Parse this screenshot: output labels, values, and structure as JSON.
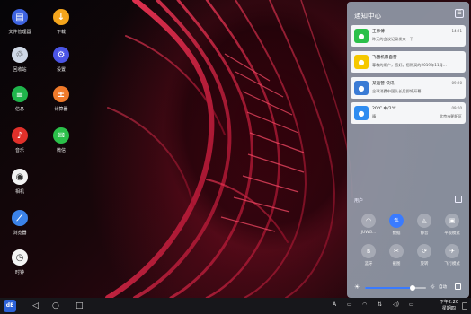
{
  "desktop": {
    "icons": [
      {
        "label": "文件管理器",
        "icon": "folder-icon",
        "color": "#3d63e0",
        "glyph": "▤"
      },
      {
        "label": "下载",
        "icon": "download-icon",
        "color": "#f5a51c",
        "glyph": "↓"
      },
      {
        "label": "回收站",
        "icon": "trash-icon",
        "color": "#cfd8e6",
        "glyph": "♲"
      },
      {
        "label": "设置",
        "icon": "settings-icon",
        "color": "#4b55e6",
        "glyph": "⚙"
      },
      {
        "label": "信息",
        "icon": "message-icon",
        "color": "#1fb44b",
        "glyph": "≡"
      },
      {
        "label": "计算器",
        "icon": "calculator-icon",
        "color": "#f07a2a",
        "glyph": "±"
      },
      {
        "label": "音乐",
        "icon": "music-icon",
        "color": "#e0302a",
        "glyph": "♪"
      },
      {
        "label": "微信",
        "icon": "wechat-icon",
        "color": "#2bc04a",
        "glyph": "✉"
      },
      {
        "label": "相机",
        "icon": "camera-icon",
        "color": "#f2f2f2",
        "glyph": "◉"
      },
      {
        "label": "浏览器",
        "icon": "browser-icon",
        "color": "#3b82e8",
        "glyph": "⟋"
      },
      {
        "label": "时钟",
        "icon": "clock-icon",
        "color": "#f4f4f4",
        "glyph": "◷"
      }
    ]
  },
  "notification_center": {
    "title": "通知中心",
    "clear_icon": "clear-icon",
    "notifications": [
      {
        "app": "王师傅",
        "body": "昨天的会议记录发来一下",
        "time": "14:21",
        "right": "",
        "icon": "wechat-icon",
        "icon_color": "#2bc04a"
      },
      {
        "app": "飞猪机票自营",
        "body": "尊敬的用户，您好。您购买的2019年11月...",
        "time": "",
        "right": "",
        "icon": "flight-icon",
        "icon_color": "#f5c800"
      },
      {
        "app": "某运营·快讯",
        "body": "全球消费中国队长后即将开幕",
        "time": "09:20",
        "right": "",
        "icon": "news-icon",
        "icon_color": "#3a7bd5"
      },
      {
        "app": "20℃ 中/2℃",
        "body": "晴",
        "time": "09:00",
        "right": "北京市朝阳区",
        "icon": "weather-icon",
        "icon_color": "#2f8cf0"
      }
    ],
    "user_label": "用户",
    "edit_icon": "edit-icon",
    "quick_settings": [
      {
        "label": "JUWG...",
        "icon": "wifi-icon",
        "on": false,
        "glyph": "◠"
      },
      {
        "label": "数据",
        "icon": "data-icon",
        "on": true,
        "glyph": "⇅"
      },
      {
        "label": "静音",
        "icon": "bell-icon",
        "on": false,
        "glyph": "◬"
      },
      {
        "label": "平板模式",
        "icon": "tablet-icon",
        "on": false,
        "glyph": "▣"
      },
      {
        "label": "蓝牙",
        "icon": "bluetooth-icon",
        "on": false,
        "glyph": "ʙ"
      },
      {
        "label": "截图",
        "icon": "screenshot-icon",
        "on": false,
        "glyph": "✂"
      },
      {
        "label": "旋转",
        "icon": "rotate-icon",
        "on": false,
        "glyph": "⟳"
      },
      {
        "label": "飞行模式",
        "icon": "airplane-icon",
        "on": false,
        "glyph": "✈"
      }
    ],
    "brightness": {
      "value": 0.78,
      "auto_label": "自动"
    }
  },
  "taskbar": {
    "start_label": "dE",
    "nav": [
      {
        "icon": "back-icon",
        "glyph": "◁"
      },
      {
        "icon": "home-icon",
        "glyph": "○"
      },
      {
        "icon": "recents-icon",
        "glyph": "□"
      }
    ],
    "tray": [
      {
        "icon": "keyboard-icon",
        "glyph": "A"
      },
      {
        "icon": "screen-icon",
        "glyph": "▭"
      },
      {
        "icon": "wifi-tray-icon",
        "glyph": "◠"
      },
      {
        "icon": "network-icon",
        "glyph": "⇅"
      },
      {
        "icon": "volume-icon",
        "glyph": "◁)"
      },
      {
        "icon": "battery-icon",
        "glyph": "▭"
      }
    ],
    "time": "下午2:20",
    "date": "星期四"
  }
}
